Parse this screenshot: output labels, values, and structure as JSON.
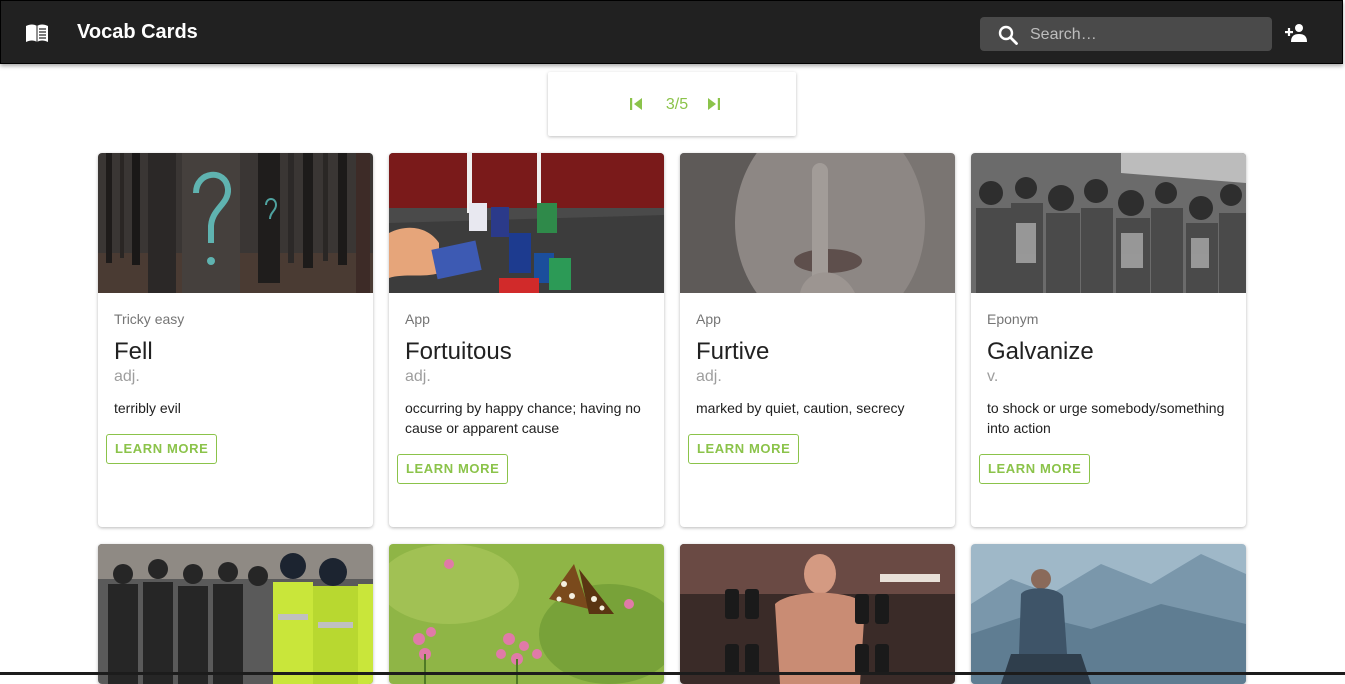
{
  "app": {
    "title": "Vocab Cards",
    "logo_icon": "book-icon",
    "search_placeholder": "Search…",
    "search_value": "",
    "add_user_icon": "person-add-icon"
  },
  "pagination": {
    "label": "3/5",
    "first_icon": "first-page-icon",
    "last_icon": "last-page-icon",
    "accent": "#8bc34a"
  },
  "cards": [
    {
      "category": "Tricky easy",
      "word": "Fell",
      "pos": "adj.",
      "definition": "terribly evil",
      "button": "LEARN MORE",
      "image": "forest with painted question mark on tree"
    },
    {
      "category": "App",
      "word": "Fortuitous",
      "pos": "adj.",
      "definition": "occurring by happy chance; having no cause or apparent cause",
      "button": "LEARN MORE",
      "image": "poker chips and cards"
    },
    {
      "category": "App",
      "word": "Furtive",
      "pos": "adj.",
      "definition": "marked by quiet, caution, secrecy",
      "button": "LEARN MORE",
      "image": "finger on lips"
    },
    {
      "category": "Eponym",
      "word": "Galvanize",
      "pos": "v.",
      "definition": "to shock or urge somebody/something into action",
      "button": "LEARN MORE",
      "image": "crowd of people"
    },
    {
      "image": "police in riot gear"
    },
    {
      "image": "butterfly on pink flowers"
    },
    {
      "image": "man lifting dumbbells"
    },
    {
      "image": "person sitting on mountain"
    }
  ],
  "colors": {
    "appbar": "#212121",
    "accent": "#8bc34a"
  }
}
